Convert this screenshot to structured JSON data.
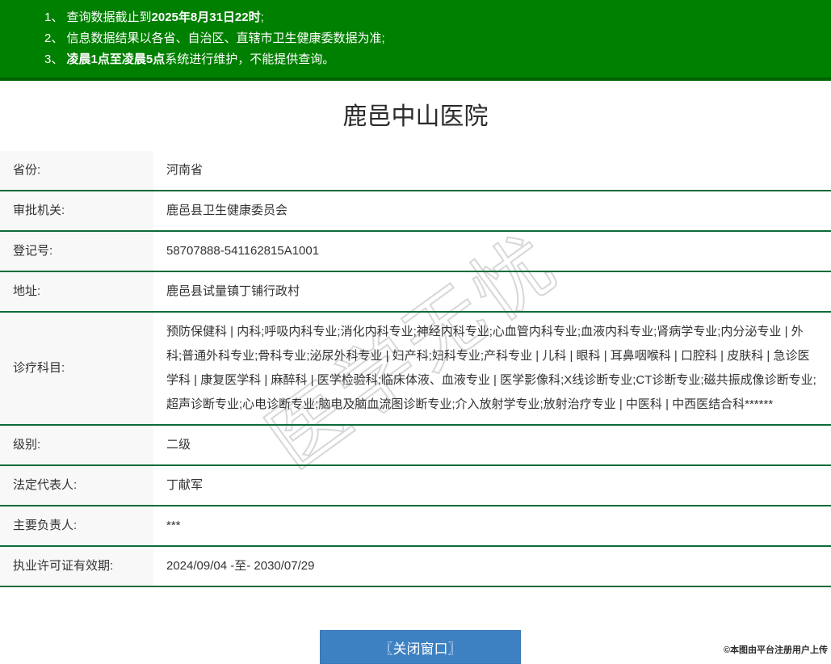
{
  "banner": {
    "notices": [
      {
        "prefix": "1、 查询数据截止到",
        "bold": "2025年8月31日22时",
        "suffix": ";"
      },
      {
        "prefix": "2、 信息数据结果以各省、自治区、直辖市卫生健康委数据为准;",
        "bold": "",
        "suffix": ""
      },
      {
        "prefix": "3、 ",
        "bold": "凌晨1点至凌晨5点",
        "suffix": "系统进行维护，不能提供查询。"
      }
    ]
  },
  "title": "鹿邑中山医院",
  "watermark": "医学无忧",
  "table": {
    "rows": [
      {
        "label": "省份:",
        "value": "河南省"
      },
      {
        "label": "审批机关:",
        "value": "鹿邑县卫生健康委员会"
      },
      {
        "label": "登记号:",
        "value": "58707888-541162815A1001"
      },
      {
        "label": "地址:",
        "value": "鹿邑县试量镇丁铺行政村"
      },
      {
        "label": "诊疗科目:",
        "value": "预防保健科 | 内科;呼吸内科专业;消化内科专业;神经内科专业;心血管内科专业;血液内科专业;肾病学专业;内分泌专业 | 外科;普通外科专业;骨科专业;泌尿外科专业 | 妇产科;妇科专业;产科专业 | 儿科 | 眼科 | 耳鼻咽喉科 | 口腔科 | 皮肤科 | 急诊医学科 | 康复医学科 | 麻醉科 | 医学检验科;临床体液、血液专业 | 医学影像科;X线诊断专业;CT诊断专业;磁共振成像诊断专业;超声诊断专业;心电诊断专业;脑电及脑血流图诊断专业;介入放射学专业;放射治疗专业 | 中医科 | 中西医结合科******"
      },
      {
        "label": "级别:",
        "value": "二级"
      },
      {
        "label": "法定代表人:",
        "value": "丁献军"
      },
      {
        "label": "主要负责人:",
        "value": "***"
      },
      {
        "label": "执业许可证有效期:",
        "value": "2024/09/04 -至- 2030/07/29"
      }
    ]
  },
  "close_button_label": "〖关闭窗口〗",
  "footer_note": "©本图由平台注册用户上传",
  "colors": {
    "banner_green": "#008000",
    "row_divider_green": "#0c6b3a",
    "label_bg": "#f8f8f8",
    "button_blue": "#3e81c2"
  }
}
